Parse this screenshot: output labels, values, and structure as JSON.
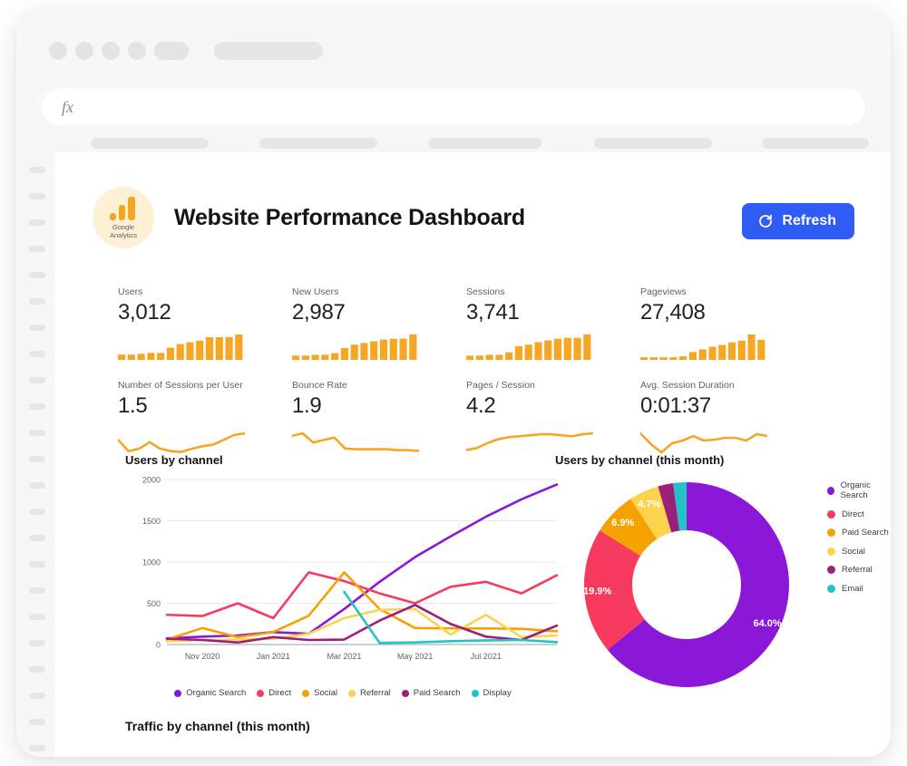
{
  "window": {
    "formula_bar": {
      "prefix": "fx",
      "value": "",
      "placeholder": ""
    }
  },
  "header": {
    "logo_line1": "Google",
    "logo_line2": "Analytics",
    "title": "Website Performance Dashboard",
    "refresh_label": "Refresh",
    "refresh_color": "#2f5cf5"
  },
  "metrics": [
    {
      "label": "Users",
      "value": "3,012",
      "spark_type": "bar",
      "spark_values": [
        6,
        6,
        7,
        8,
        8,
        14,
        18,
        20,
        22,
        26,
        26,
        26,
        29
      ]
    },
    {
      "label": "New Users",
      "value": "2,987",
      "spark_type": "bar",
      "spark_values": [
        5,
        5,
        6,
        6,
        8,
        14,
        18,
        20,
        22,
        24,
        25,
        25,
        30
      ]
    },
    {
      "label": "Sessions",
      "value": "3,741",
      "spark_type": "bar",
      "spark_values": [
        5,
        5,
        6,
        6,
        9,
        16,
        18,
        21,
        23,
        25,
        26,
        26,
        30
      ]
    },
    {
      "label": "Pageviews",
      "value": "27,408",
      "spark_type": "bar",
      "spark_values": [
        3,
        3,
        3,
        3,
        4,
        9,
        12,
        15,
        17,
        20,
        22,
        29,
        23
      ]
    },
    {
      "label": "Number of Sessions per User",
      "value": "1.5",
      "spark_type": "line",
      "spark_values": [
        20,
        6,
        9,
        17,
        9,
        6,
        5,
        9,
        12,
        14,
        20,
        26,
        28
      ]
    },
    {
      "label": "Bounce Rate",
      "value": "1.9",
      "spark_type": "line",
      "spark_values": [
        24,
        27,
        16,
        19,
        22,
        9,
        8,
        8,
        8,
        8,
        7,
        7,
        6
      ]
    },
    {
      "label": "Pages / Session",
      "value": "4.2",
      "spark_type": "line",
      "spark_values": [
        6,
        8,
        13,
        17,
        19,
        20,
        21,
        22,
        22,
        21,
        20,
        22,
        23
      ]
    },
    {
      "label": "Avg. Session Duration",
      "value": "0:01:37",
      "spark_type": "line",
      "spark_values": [
        25,
        13,
        4,
        14,
        17,
        22,
        17,
        18,
        20,
        20,
        17,
        24,
        22
      ]
    }
  ],
  "line_chart": {
    "title": "Users by channel",
    "legend_position": "bottom"
  },
  "donut_chart": {
    "title": "Users by channel (this month)",
    "legend_position": "right"
  },
  "bottom_section": {
    "title": "Traffic by channel (this month)"
  },
  "chart_data": [
    {
      "type": "line",
      "title": "Users by channel",
      "xlabel": "",
      "ylabel": "",
      "ylim": [
        0,
        2000
      ],
      "yticks": [
        0,
        500,
        1000,
        1500,
        2000
      ],
      "grid": true,
      "x": [
        "Oct 2020",
        "Nov 2020",
        "Dec 2020",
        "Jan 2021",
        "Feb 2021",
        "Mar 2021",
        "Apr 2021",
        "May 2021",
        "Jun 2021",
        "Jul 2021",
        "Aug 2021",
        "Sep 2021"
      ],
      "xticks": [
        "Nov 2020",
        "Jan 2021",
        "Mar 2021",
        "May 2021",
        "Jul 2021"
      ],
      "series": [
        {
          "name": "Organic Search",
          "color": "#8b18d6",
          "values": [
            75,
            95,
            110,
            150,
            130,
            430,
            760,
            1060,
            1310,
            1550,
            1760,
            1940
          ]
        },
        {
          "name": "Direct",
          "color": "#f63b5f",
          "values": [
            360,
            345,
            500,
            320,
            875,
            770,
            620,
            500,
            700,
            760,
            620,
            840
          ]
        },
        {
          "name": "Social",
          "color": "#f5a200",
          "values": [
            60,
            200,
            90,
            150,
            350,
            875,
            430,
            200,
            195,
            195,
            190,
            160
          ]
        },
        {
          "name": "Referral",
          "color": "#fcd34d",
          "values": [
            40,
            55,
            60,
            70,
            130,
            320,
            420,
            430,
            120,
            360,
            90,
            110
          ]
        },
        {
          "name": "Paid Search",
          "color": "#9c1f7a",
          "values": [
            70,
            55,
            25,
            90,
            55,
            60,
            290,
            480,
            250,
            95,
            55,
            230
          ]
        },
        {
          "name": "Display",
          "color": "#24c2c6",
          "values": [
            null,
            null,
            null,
            null,
            null,
            640,
            20,
            25,
            40,
            50,
            55,
            30
          ]
        }
      ]
    },
    {
      "type": "pie",
      "title": "Users by channel (this month)",
      "donut": true,
      "labels": [
        "Organic Search",
        "Direct",
        "Paid Search",
        "Social",
        "Referral",
        "Email"
      ],
      "values": [
        64.0,
        19.9,
        6.9,
        4.7,
        2.4,
        2.1
      ],
      "value_labels": [
        "64.0%",
        "19.9%",
        "6.9%",
        "4.7%",
        "",
        ""
      ],
      "colors": [
        "#8b18d6",
        "#f63b5f",
        "#f5a200",
        "#fcd34d",
        "#9c1f7a",
        "#24c2c6"
      ]
    }
  ]
}
